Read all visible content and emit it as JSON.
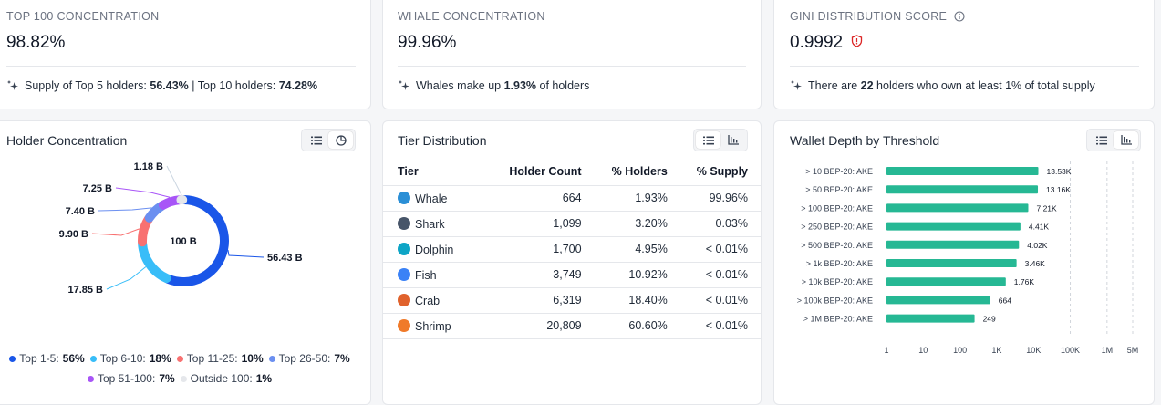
{
  "stats": [
    {
      "label": "TOP 100 CONCENTRATION",
      "value": "98.82%",
      "note_pre": "Supply of Top 5 holders: ",
      "note_b1": "56.43%",
      "note_mid": " | Top 10 holders: ",
      "note_b2": "74.28%",
      "note_post": ""
    },
    {
      "label": "WHALE CONCENTRATION",
      "value": "99.96%",
      "note_pre": "Whales make up ",
      "note_b1": "1.93%",
      "note_mid": " of holders",
      "note_b2": "",
      "note_post": ""
    },
    {
      "label": "GINI DISTRIBUTION SCORE",
      "value": "0.9992",
      "note_pre": "There are ",
      "note_b1": "22",
      "note_mid": " holders who own at least 1% of total supply",
      "note_b2": "",
      "note_post": ""
    }
  ],
  "holder": {
    "title": "Holder Concentration",
    "center": "100 B",
    "slices": [
      {
        "label": "56.43 B",
        "value": 56.43,
        "color": "#1a56e8"
      },
      {
        "label": "17.85 B",
        "value": 17.85,
        "color": "#38bdf8"
      },
      {
        "label": "9.90 B",
        "value": 9.9,
        "color": "#f87171"
      },
      {
        "label": "7.40 B",
        "value": 7.4,
        "color": "#6b8ff0"
      },
      {
        "label": "7.25 B",
        "value": 7.25,
        "color": "#a855f7"
      },
      {
        "label": "1.18 B",
        "value": 1.18,
        "color": "#e5e7eb"
      }
    ],
    "legend": [
      {
        "name": "Top 1-5:",
        "pct": "56%",
        "color": "#1a56e8"
      },
      {
        "name": "Top 6-10:",
        "pct": "18%",
        "color": "#38bdf8"
      },
      {
        "name": "Top 11-25:",
        "pct": "10%",
        "color": "#f87171"
      },
      {
        "name": "Top 26-50:",
        "pct": "7%",
        "color": "#6b8ff0"
      },
      {
        "name": "Top 51-100:",
        "pct": "7%",
        "color": "#a855f7"
      },
      {
        "name": "Outside 100:",
        "pct": "1%",
        "color": "#e5e7eb"
      }
    ]
  },
  "tiers": {
    "title": "Tier Distribution",
    "headers": [
      "Tier",
      "Holder Count",
      "% Holders",
      "% Supply"
    ],
    "rows": [
      {
        "tier": "Whale",
        "count": "664",
        "holders": "1.93%",
        "supply": "99.96%",
        "color": "#2b8fd6"
      },
      {
        "tier": "Shark",
        "count": "1,099",
        "holders": "3.20%",
        "supply": "0.03%",
        "color": "#475569"
      },
      {
        "tier": "Dolphin",
        "count": "1,700",
        "holders": "4.95%",
        "supply": "< 0.01%",
        "color": "#0ea5c6"
      },
      {
        "tier": "Fish",
        "count": "3,749",
        "holders": "10.92%",
        "supply": "< 0.01%",
        "color": "#3b82f6"
      },
      {
        "tier": "Crab",
        "count": "6,319",
        "holders": "18.40%",
        "supply": "< 0.01%",
        "color": "#e0622c"
      },
      {
        "tier": "Shrimp",
        "count": "20,809",
        "holders": "60.60%",
        "supply": "< 0.01%",
        "color": "#f07a2a"
      }
    ]
  },
  "depth": {
    "title": "Wallet Depth by Threshold",
    "bar_color": "#26b894",
    "rows": [
      {
        "label": "> 10 BEP-20: AKE",
        "value": 13530,
        "text": "13.53K"
      },
      {
        "label": "> 50 BEP-20: AKE",
        "value": 13160,
        "text": "13.16K"
      },
      {
        "label": "> 100 BEP-20: AKE",
        "value": 7210,
        "text": "7.21K"
      },
      {
        "label": "> 250 BEP-20: AKE",
        "value": 4410,
        "text": "4.41K"
      },
      {
        "label": "> 500 BEP-20: AKE",
        "value": 4020,
        "text": "4.02K"
      },
      {
        "label": "> 1k BEP-20: AKE",
        "value": 3460,
        "text": "3.46K"
      },
      {
        "label": "> 10k BEP-20: AKE",
        "value": 1760,
        "text": "1.76K"
      },
      {
        "label": "> 100k BEP-20: AKE",
        "value": 664,
        "text": "664"
      },
      {
        "label": "> 1M BEP-20: AKE",
        "value": 249,
        "text": "249"
      }
    ],
    "ticks": [
      {
        "v": 1,
        "label": "1"
      },
      {
        "v": 10,
        "label": "10"
      },
      {
        "v": 100,
        "label": "100"
      },
      {
        "v": 1000,
        "label": "1K"
      },
      {
        "v": 10000,
        "label": "10K"
      },
      {
        "v": 100000,
        "label": "100K"
      },
      {
        "v": 1000000,
        "label": "1M"
      },
      {
        "v": 5000000,
        "label": "5M"
      }
    ]
  }
}
